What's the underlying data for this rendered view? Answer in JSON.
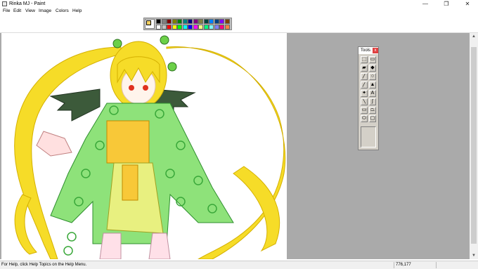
{
  "window": {
    "title": "Rinka MJ - Paint",
    "minimize_icon": "minimize-icon",
    "maximize_icon": "restore-icon",
    "close_icon": "close-icon",
    "minimize_glyph": "—",
    "maximize_glyph": "❐",
    "close_glyph": "✕"
  },
  "menu": {
    "items": [
      "File",
      "Edit",
      "View",
      "Image",
      "Colors",
      "Help"
    ]
  },
  "palette": {
    "foreground": "#f4d060",
    "background": "#ffffff",
    "colors": [
      "#000000",
      "#808080",
      "#800000",
      "#808000",
      "#008000",
      "#008080",
      "#000080",
      "#800080",
      "#808040",
      "#004040",
      "#0080ff",
      "#004080",
      "#8000ff",
      "#804000",
      "#ffffff",
      "#c0c0c0",
      "#ff0000",
      "#ffff00",
      "#00ff00",
      "#00ffff",
      "#0000ff",
      "#ff00ff",
      "#ffff80",
      "#00ff80",
      "#80ffff",
      "#8080ff",
      "#ff0080",
      "#ff8040"
    ]
  },
  "toolbox": {
    "title": "Tools",
    "close_glyph": "x",
    "tools": [
      {
        "name": "free-select",
        "glyph": "⬚"
      },
      {
        "name": "select",
        "glyph": "▭"
      },
      {
        "name": "eraser",
        "glyph": "▰"
      },
      {
        "name": "fill",
        "glyph": "◆"
      },
      {
        "name": "color-picker",
        "glyph": "╱"
      },
      {
        "name": "magnifier",
        "glyph": "○"
      },
      {
        "name": "pencil",
        "glyph": "╱"
      },
      {
        "name": "brush",
        "glyph": "▲"
      },
      {
        "name": "airbrush",
        "glyph": "✦"
      },
      {
        "name": "text",
        "glyph": "A"
      },
      {
        "name": "line",
        "glyph": "╲"
      },
      {
        "name": "curve",
        "glyph": "∫"
      },
      {
        "name": "rectangle",
        "glyph": "▭"
      },
      {
        "name": "polygon",
        "glyph": "⏢"
      },
      {
        "name": "ellipse",
        "glyph": "⬭"
      },
      {
        "name": "rounded-rectangle",
        "glyph": "▢"
      }
    ]
  },
  "status": {
    "help": "For Help, click Help Topics on the Help Menu.",
    "coords": "776,177"
  },
  "scroll": {
    "up_glyph": "▲",
    "down_glyph": "▼"
  }
}
